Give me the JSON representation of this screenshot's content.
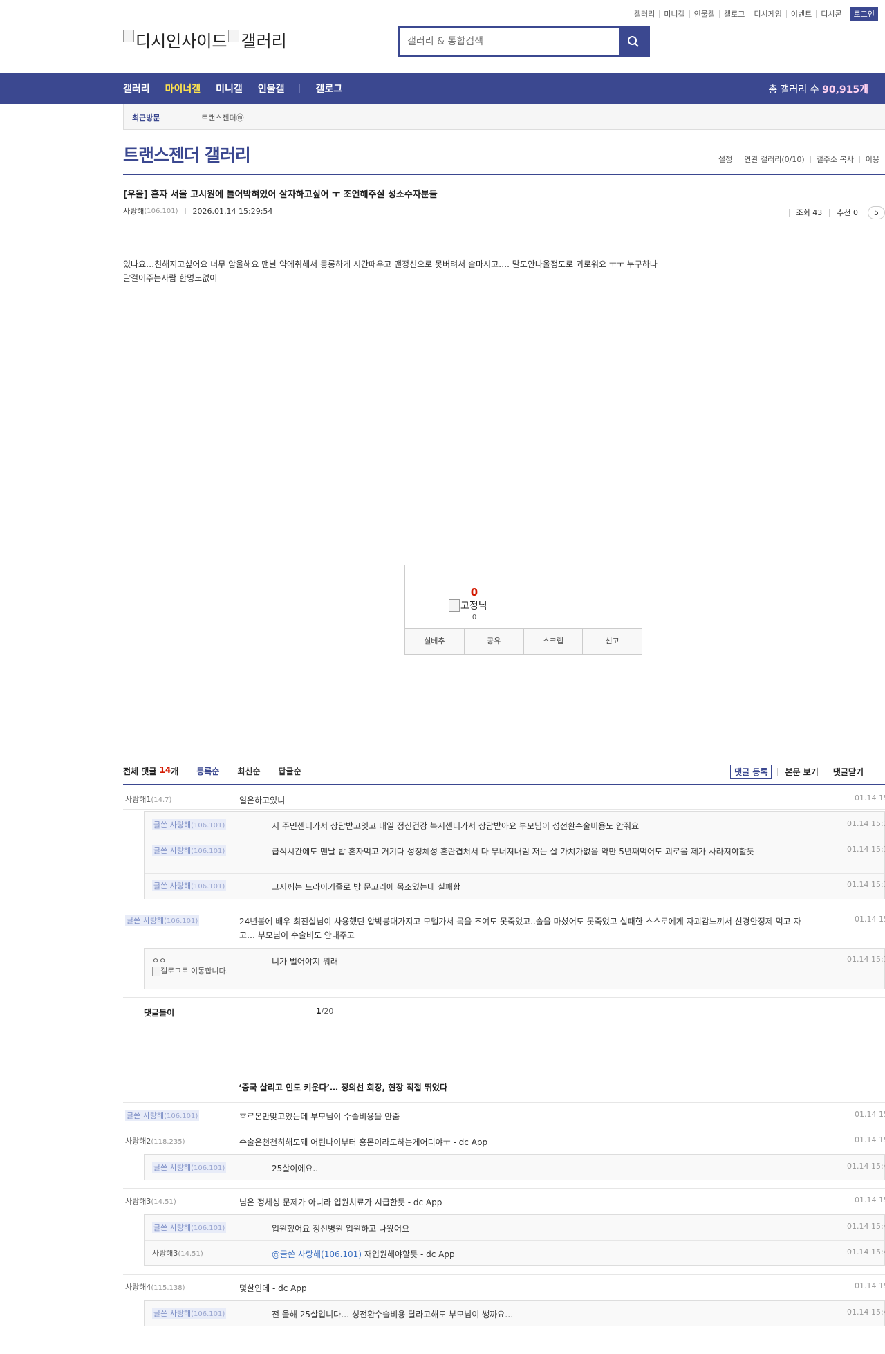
{
  "util_links": [
    "갤러리",
    "미니갤",
    "인물갤",
    "갤로그",
    "디시게임",
    "이벤트",
    "디시콘"
  ],
  "login_label": "로그인",
  "logo": {
    "alt1": "디시인사이드",
    "alt2": "갤러리"
  },
  "search": {
    "placeholder": "갤러리 & 통합검색",
    "icon": "search-icon"
  },
  "gnb": {
    "items": [
      "갤러리",
      "마이너갤",
      "미니갤",
      "인물갤",
      "갤로그"
    ],
    "active": "마이너갤",
    "total_label": "총 갤러리 수",
    "total_value": "90,915개"
  },
  "visit": {
    "label": "최근방문",
    "gallery": "트랜스젠더ⓜ"
  },
  "gallery_title": "트랜스젠더 갤러리",
  "gallery_opts": [
    "설정",
    "연관 갤러리(0/10)",
    "갤주소 복사",
    "이용"
  ],
  "post": {
    "title": "[우울] 혼자 서울 고시원에 틀어박혀있어 살자하고싶어 ㅜ 조언해주실 성소수자분들",
    "author": "사랑해",
    "author_ip": "(106.101)",
    "date": "2026.01.14 15:29:54",
    "views": "조회 43",
    "recommend": "추천 0",
    "comments_badge": "5",
    "body_line1": "있나요…친해지고싶어요 너무 암울해요 맨날 약에취해서 몽롱하게 시간때우고 맨정신으로 못버텨서 술마시고…. 말도안나올정도로 괴로워요 ㅜㅜ 누구하나",
    "body_line2": "말걸어주는사람 한명도없어"
  },
  "recommend_box": {
    "count": "0",
    "img_alt": "고정닉",
    "sub_count": "0",
    "buttons": [
      "실베추",
      "공유",
      "스크랩",
      "신고"
    ]
  },
  "comments": {
    "total_label": "전체 댓글",
    "total_count": "14",
    "total_unit": "개",
    "sort": [
      "등록순",
      "최신순",
      "답글순"
    ],
    "right": [
      "댓글 등록",
      "본문 보기",
      "댓글닫기"
    ],
    "writer_prefix": "글쓴",
    "rows": [
      {
        "nick": "사랑해1",
        "ip": "(14.7)",
        "text": "일은하고있니",
        "date": "01.14 15"
      },
      {
        "nick": "사랑해",
        "ip": "(106.101)",
        "text": "저 주민센터가서 상담받고잇고 내일 정신건강 복지센터가서 상담받아요 부모님이 성전환수술비용도 안줘요",
        "date": "01.14 15:3"
      },
      {
        "nick": "사랑해",
        "ip": "(106.101)",
        "text": "급식시간에도 맨날 밥 혼자먹고 거기다 성정체성 혼란겹쳐서 다 무너져내림 저는 살 가치가없음 약만 5년째먹어도 괴로움 제가 사라져야할듯",
        "date": "01.14 15:3"
      },
      {
        "nick": "사랑해",
        "ip": "(106.101)",
        "text": "그저께는 드라이기줄로 방 문고리에 목조였는데 실패함",
        "date": "01.14 15:3"
      },
      {
        "nick": "사랑해",
        "ip": "(106.101)",
        "text": "24년봄에 배우 최진실님이 사용했던 압박붕대가지고 모텔가서 목을 조여도 못죽었고..술을 마셨어도 못죽었고 실패한 스스로에게 자괴감느껴서 신경안정제 먹고 자고… 부모님이 수술비도 안내주고",
        "date": "01.14 15"
      },
      {
        "nick": "ㅇㅇ",
        "ip": "",
        "gallog_alt": "갤로그로 이동합니다.",
        "text": "니가 벌어야지 뭐래",
        "date": "01.14 15:3"
      },
      {
        "nick": "사랑해",
        "ip": "(106.101)",
        "text": "호르몬만맞고있는데 부모님이 수술비용을 안줌",
        "date": "01.14 15"
      },
      {
        "nick": "사랑해2",
        "ip": "(118.235)",
        "text": "수술은천천히해도돼 어린나이부터 홍몬이라도하는게어디야ㅜ - dc App",
        "date": "01.14 15"
      },
      {
        "nick": "사랑해",
        "ip": "(106.101)",
        "text": "25살이에요..",
        "date": "01.14 15:4"
      },
      {
        "nick": "사랑해3",
        "ip": "(14.51)",
        "text": "님은 정체성 문제가 아니라 입원치료가 시급한듯 - dc App",
        "date": "01.14 15"
      },
      {
        "nick": "사랑해",
        "ip": "(106.101)",
        "text": "입원했어요 정신병원 입원하고 나왔어요",
        "date": "01.14 15:4"
      },
      {
        "nick": "사랑해3",
        "ip": "(14.51)",
        "mention": "@글쓴 사랑해(106.101)",
        "text": "재입원해야할듯 - dc App",
        "date": "01.14 15:4"
      },
      {
        "nick": "사랑해4",
        "ip": "(115.138)",
        "text": "몇살인데 - dc App",
        "date": "01.14 15"
      },
      {
        "nick": "사랑해",
        "ip": "(106.101)",
        "text": "전 올해 25살입니다… 성전환수술비용 달라고해도 부모님이 쌩까요…",
        "date": "01.14 15:4"
      }
    ],
    "reply_bot_label": "댓글돌이",
    "page_current": "1",
    "page_total": "/20",
    "news_title": "‘중국 살리고 인도 키운다’… 정의선 회장, 현장 직접 뛰었다"
  },
  "colors": {
    "accent": "#3b4890",
    "highlight": "#ffe44d",
    "red": "#d31900"
  }
}
